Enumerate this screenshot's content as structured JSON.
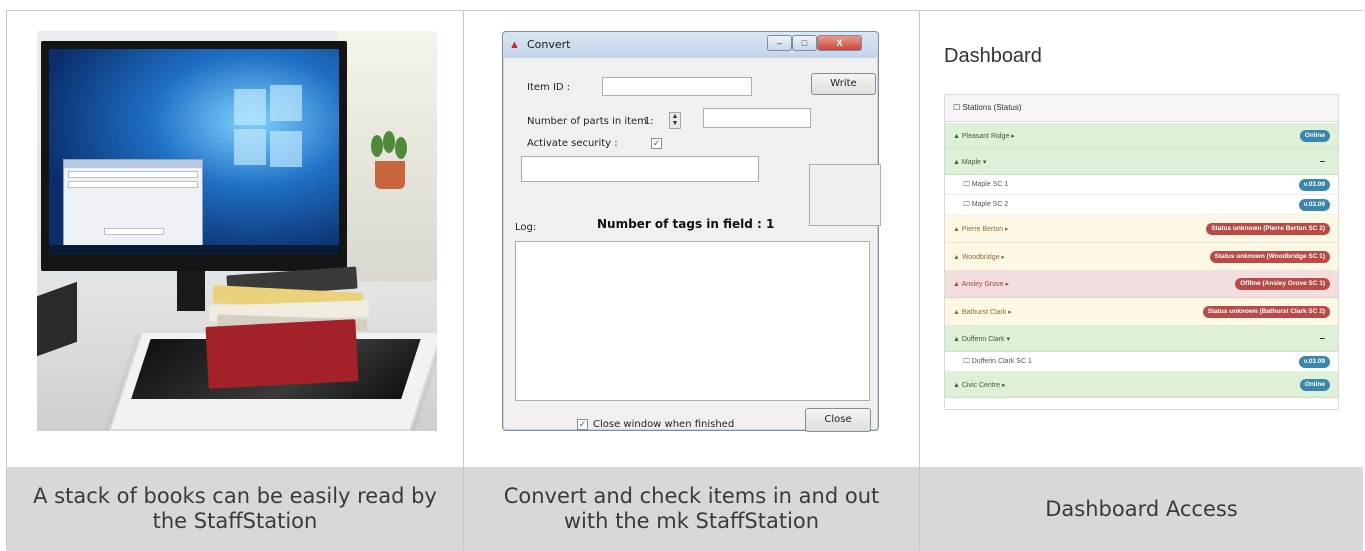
{
  "captions": [
    "A stack of books can be easily read by the StaffStation",
    "Convert and check items in and out with the mk StaffStation",
    "Dashboard Access"
  ],
  "convert_window": {
    "title": "Convert",
    "controls": {
      "minimize": "–",
      "maximize": "□",
      "close": "X"
    },
    "item_id_label": "Item ID :",
    "item_id_value": "",
    "write_button": "Write",
    "parts_label": "Number of parts in item :",
    "parts_value": "1",
    "activate_security_label": "Activate security :",
    "activate_security_checked": true,
    "log_label": "Log:",
    "tags_in_field": "Number of tags in field : 1",
    "close_when_finished_label": "Close window when finished",
    "close_when_finished_checked": true,
    "close_button": "Close"
  },
  "dashboard": {
    "title": "Dashboard",
    "panel_heading": "Stations (Status)",
    "rows": [
      {
        "name": "Pleasant Ridge ▸",
        "badge": "Online",
        "status": "online"
      },
      {
        "name": "Maple ▾",
        "badge": "–",
        "status": "group"
      },
      {
        "name": "Maple SC 1",
        "badge": "v.03.09",
        "status": "sub"
      },
      {
        "name": "Maple SC 2",
        "badge": "v.03.09",
        "status": "sub"
      },
      {
        "name": "Pierre Berton ▸",
        "badge": "Status unknown (Pierre Berton SC 2)",
        "status": "warn"
      },
      {
        "name": "Woodbridge ▸",
        "badge": "Status unknown (Woodbridge SC 1)",
        "status": "warn"
      },
      {
        "name": "Ansley Grove ▸",
        "badge": "Offline (Ansley Grove SC 1)",
        "status": "offline"
      },
      {
        "name": "Bathurst Clark ▸",
        "badge": "Status unknown (Bathurst Clark SC 2)",
        "status": "warn"
      },
      {
        "name": "Dufferin Clark ▾",
        "badge": "–",
        "status": "group"
      },
      {
        "name": "Dufferin Clark SC 1",
        "badge": "v.03.09",
        "status": "sub"
      },
      {
        "name": "Civic Centre ▸",
        "badge": "Online",
        "status": "online"
      }
    ]
  },
  "colors": {
    "caption_bg": "#d8d8d8",
    "online_row": "#dff0d8",
    "warn_row": "#fcf8e3",
    "offline_row": "#f2dede",
    "badge_blue": "#3a87ad",
    "badge_red": "#b94a48"
  }
}
